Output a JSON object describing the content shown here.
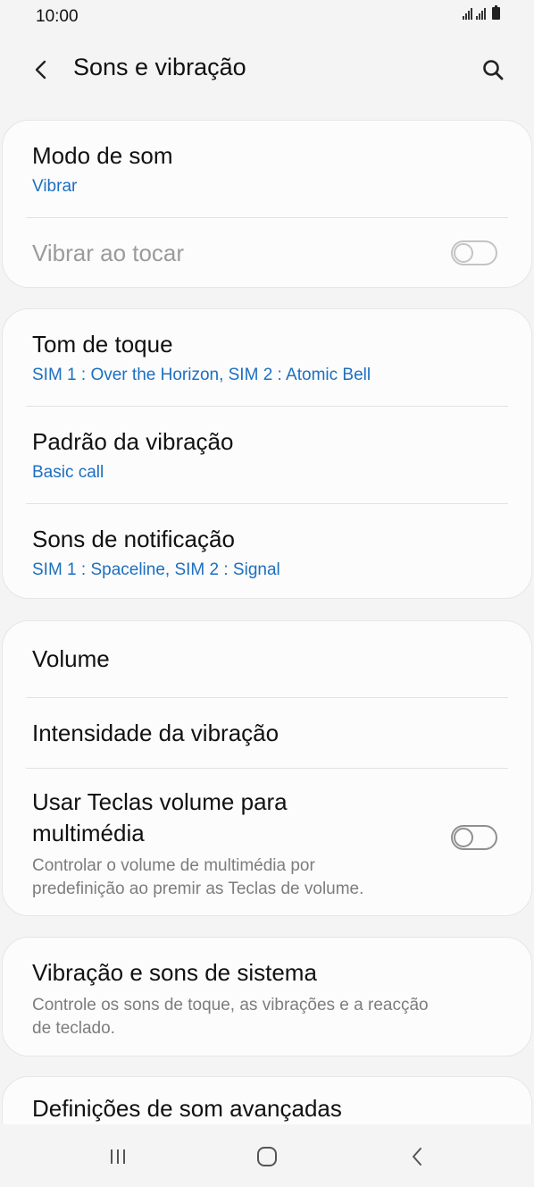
{
  "status_bar": {
    "time": "10:00"
  },
  "header": {
    "title": "Sons e vibração",
    "back_icon": "chevron-left-icon",
    "search_icon": "search-icon"
  },
  "groups": [
    {
      "rows": [
        {
          "title": "Modo de som",
          "subtitle": "Vibrar"
        },
        {
          "title": "Vibrar ao tocar",
          "toggle": false,
          "disabled": true
        }
      ]
    },
    {
      "rows": [
        {
          "title": "Tom de toque",
          "subtitle": "SIM 1 : Over the Horizon, SIM 2 : Atomic Bell"
        },
        {
          "title": "Padrão da vibração",
          "subtitle": "Basic call"
        },
        {
          "title": "Sons de notificação",
          "subtitle": "SIM 1 : Spaceline, SIM 2 : Signal"
        }
      ]
    },
    {
      "rows": [
        {
          "title": "Volume"
        },
        {
          "title": "Intensidade da vibração"
        },
        {
          "title_line1": "Usar Teclas volume para",
          "title_line2": "multimédia",
          "desc_line1": "Controlar o volume de multimédia por",
          "desc_line2": "predefinição ao premir as Teclas de volume.",
          "toggle": false
        }
      ]
    },
    {
      "rows": [
        {
          "title": "Vibração e sons de sistema",
          "desc_line1": "Controle os sons de toque, as vibrações e a reacção",
          "desc_line2": "de teclado."
        }
      ]
    },
    {
      "rows": [
        {
          "title": "Definições de som avançadas"
        }
      ]
    }
  ],
  "colors": {
    "accent": "#1d6fc0",
    "background": "#f4f4f4",
    "card": "#fcfcfc"
  },
  "nav_bar": {
    "icons": [
      "recents-icon",
      "home-icon",
      "back-icon"
    ]
  }
}
